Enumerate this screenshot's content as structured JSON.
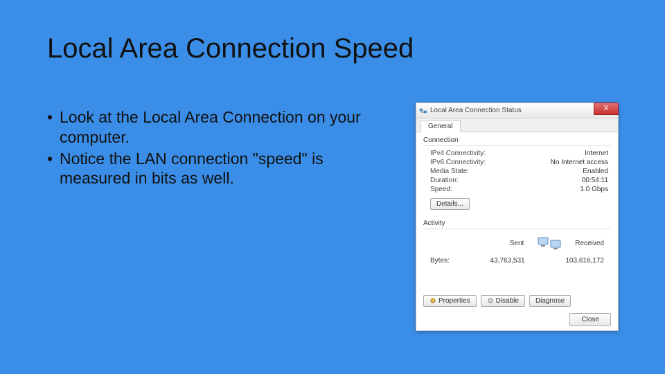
{
  "slide": {
    "title": "Local Area Connection Speed",
    "bullets": [
      "Look at the Local Area Connection on your computer.",
      "Notice the LAN connection \"speed\" is measured in bits as well."
    ]
  },
  "dialog": {
    "title": "Local Area Connection Status",
    "close_x": "X",
    "tab_general": "General",
    "section_connection": "Connection",
    "rows": {
      "ipv4_label": "IPv4 Connectivity:",
      "ipv4_value": "Internet",
      "ipv6_label": "IPv6 Connectivity:",
      "ipv6_value": "No Internet access",
      "media_label": "Media State:",
      "media_value": "Enabled",
      "duration_label": "Duration:",
      "duration_value": "00:54:11",
      "speed_label": "Speed:",
      "speed_value": "1.0 Gbps"
    },
    "details_btn": "Details...",
    "section_activity": "Activity",
    "activity": {
      "sent_label": "Sent",
      "received_label": "Received",
      "bytes_label": "Bytes:",
      "bytes_sent": "43,763,531",
      "bytes_received": "103,616,172"
    },
    "buttons": {
      "properties": "Properties",
      "disable": "Disable",
      "diagnose": "Diagnose",
      "close": "Close"
    }
  }
}
